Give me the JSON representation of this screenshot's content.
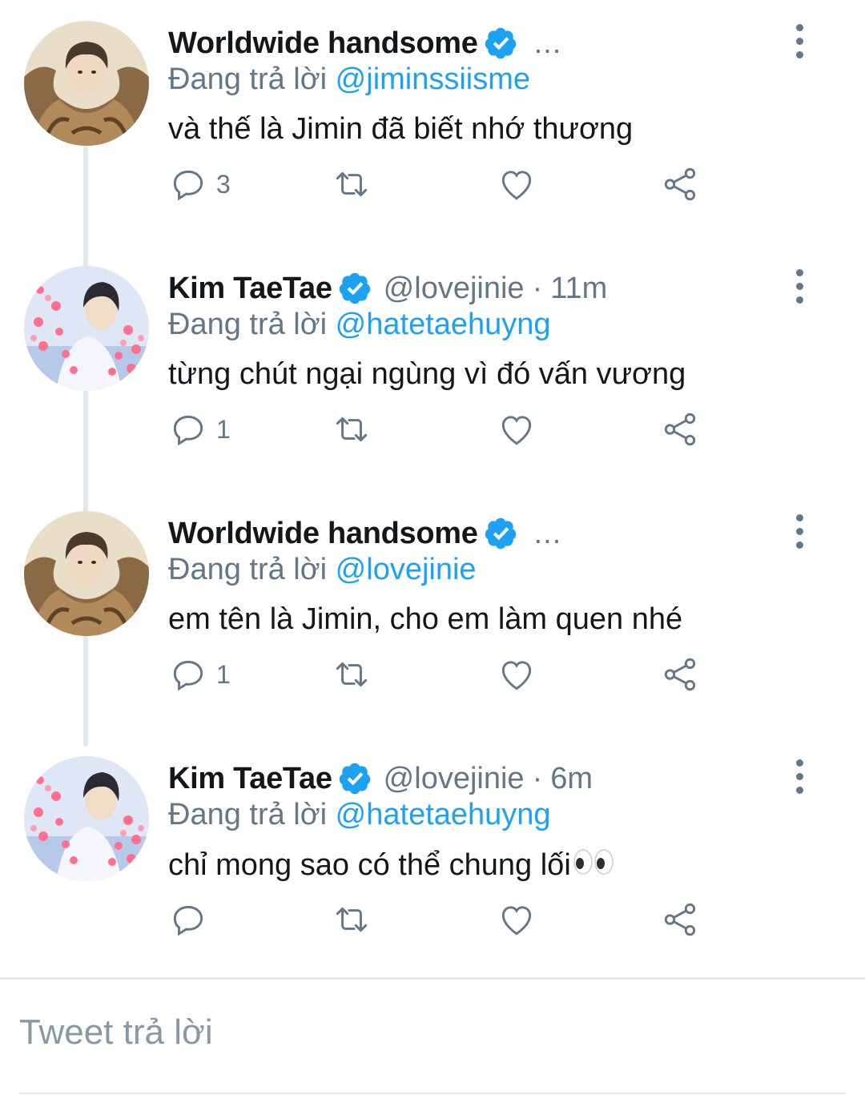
{
  "colors": {
    "accent": "#1da1f2",
    "secondary": "#657786",
    "text": "#14171a",
    "divider": "#e1e8ed"
  },
  "replying_prefix": "Đang trả lời",
  "tweets": [
    {
      "name": "Worldwide handsome",
      "handle": "",
      "time": "",
      "truncated": "...",
      "reply_to": "@jiminssiisme",
      "text": "và thế là Jimin đã biết nhớ thương",
      "reply_count": "3",
      "avatar": "fur-coat-avatar"
    },
    {
      "name": "Kim TaeTae",
      "handle": "@lovejinie",
      "time": "11m",
      "truncated": "",
      "reply_to": "@hatetaehuyng",
      "text": "từng chút ngại ngùng vì đó vấn vương",
      "reply_count": "1",
      "avatar": "hearts-avatar"
    },
    {
      "name": "Worldwide handsome",
      "handle": "",
      "time": "",
      "truncated": "...",
      "reply_to": "@lovejinie",
      "text": "em tên là Jimin, cho em làm quen nhé",
      "reply_count": "1",
      "avatar": "fur-coat-avatar"
    },
    {
      "name": "Kim TaeTae",
      "handle": "@lovejinie",
      "time": "6m",
      "truncated": "",
      "reply_to": "@hatetaehuyng",
      "text": "chỉ mong sao có thể chung lối",
      "text_emoji": "eyes-emoji",
      "reply_count": "",
      "avatar": "hearts-avatar"
    }
  ],
  "compose": {
    "placeholder": "Tweet trả lời"
  }
}
